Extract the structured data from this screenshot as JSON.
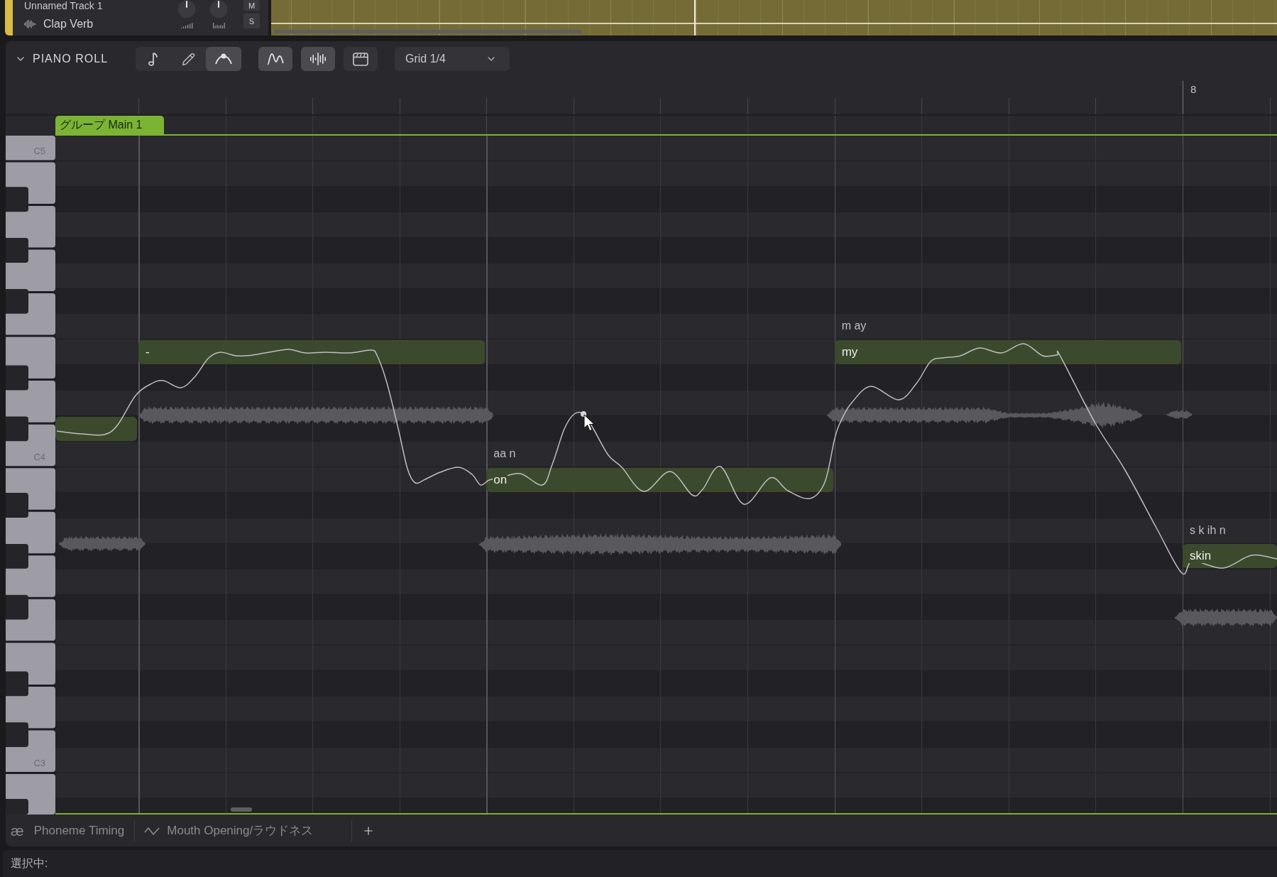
{
  "track": {
    "name": "Unnamed Track 1",
    "instrument": "Clap Verb",
    "mute": {
      "label": "M",
      "on": false
    },
    "solo": {
      "label": "S",
      "on": false
    }
  },
  "piano_roll": {
    "title": "PIANO ROLL",
    "expanded": true,
    "tools": [
      {
        "kind": "note",
        "selected": false
      },
      {
        "kind": "pencil",
        "selected": false
      },
      {
        "kind": "curve",
        "selected": true
      }
    ],
    "toggles": [
      {
        "kind": "pitch",
        "on": true
      },
      {
        "kind": "waveform",
        "on": true
      },
      {
        "kind": "video",
        "on": false
      }
    ],
    "grid_select": {
      "value": "Grid 1/4"
    }
  },
  "ruler": {
    "bar_label": "8"
  },
  "group": {
    "label": "グループ Main 1"
  },
  "keyboard": {
    "labels": [
      "C5",
      "C4",
      "C3"
    ]
  },
  "notes": [
    {
      "selected": false
    },
    {
      "lyric": "-",
      "selected": false
    },
    {
      "phonemes": "aa n",
      "lyric": "on",
      "selected": false
    },
    {
      "phonemes": "m ay",
      "lyric": "my",
      "selected": false
    },
    {
      "phonemes": "s k ih n",
      "lyric": "skin",
      "selected": false
    }
  ],
  "bottom_tabs": [
    {
      "kind": "phoneme",
      "glyph": "æ",
      "label": "Phoneme Timing",
      "selected": false
    },
    {
      "kind": "curve",
      "label": "Mouth Opening/ラウドネス",
      "selected": false
    }
  ],
  "status_bar": {
    "label": "選択中:"
  }
}
